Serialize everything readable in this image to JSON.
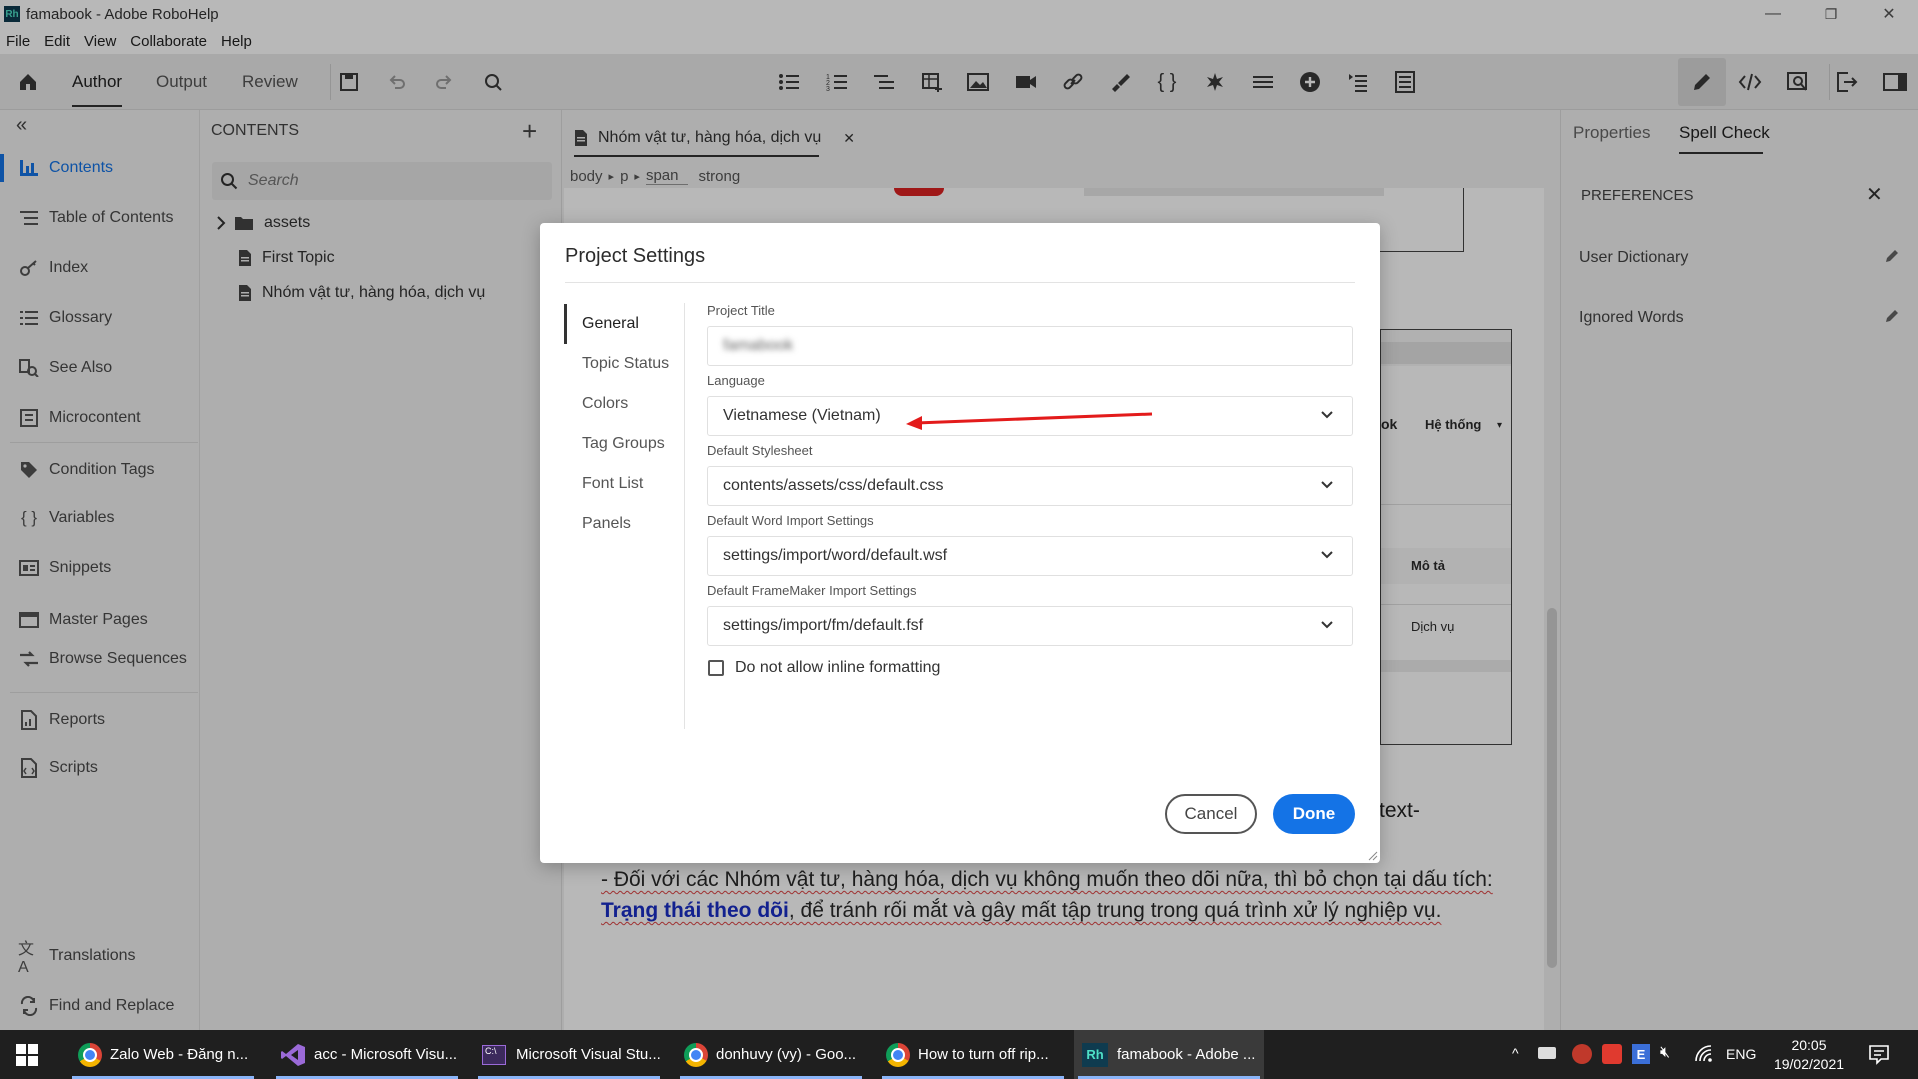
{
  "window": {
    "app_logo": "Rh",
    "title": "famabook - Adobe RoboHelp",
    "controls": {
      "minimize": "—",
      "restore": "❐",
      "close": "✕"
    }
  },
  "menu": [
    "File",
    "Edit",
    "View",
    "Collaborate",
    "Help"
  ],
  "toolbar": {
    "modes": [
      "Author",
      "Output",
      "Review"
    ],
    "active_mode": "Author"
  },
  "leftnav": {
    "collapse_icon": "«",
    "items": [
      {
        "label": "Contents",
        "icon": "contents-icon",
        "active": true
      },
      {
        "label": "Table of Contents",
        "icon": "toc-icon"
      },
      {
        "label": "Index",
        "icon": "index-icon"
      },
      {
        "label": "Glossary",
        "icon": "glossary-icon"
      },
      {
        "label": "See Also",
        "icon": "see-also-icon"
      },
      {
        "label": "Microcontent",
        "icon": "microcontent-icon"
      },
      {
        "label": "Condition Tags",
        "icon": "tag-icon"
      },
      {
        "label": "Variables",
        "icon": "variables-icon"
      },
      {
        "label": "Snippets",
        "icon": "snippets-icon"
      },
      {
        "label": "Master Pages",
        "icon": "master-pages-icon"
      },
      {
        "label": "Browse Sequences",
        "icon": "browse-sequences-icon"
      },
      {
        "label": "Reports",
        "icon": "reports-icon"
      },
      {
        "label": "Scripts",
        "icon": "scripts-icon"
      }
    ],
    "bottom_items": [
      {
        "label": "Translations",
        "icon": "translations-icon"
      },
      {
        "label": "Find and Replace",
        "icon": "find-replace-icon"
      }
    ]
  },
  "contents_panel": {
    "title": "CONTENTS",
    "add": "+",
    "search_placeholder": "Search",
    "tree": [
      {
        "label": "assets",
        "type": "folder"
      },
      {
        "label": "First Topic",
        "type": "file"
      },
      {
        "label": "Nhóm vật tư, hàng hóa, dịch vụ",
        "type": "file"
      }
    ]
  },
  "editor": {
    "tab_title": "Nhóm vật tư, hàng hóa, dịch vụ",
    "tab_close": "✕",
    "breadcrumb": [
      "body",
      "p",
      "span",
      "strong"
    ],
    "breadcrumb_sep": "▸",
    "bg_table": {
      "col_ok": "ok",
      "col_system": "Hệ thống",
      "col_desc": "Mô tả",
      "cell_service": "Dịch vụ"
    },
    "partial_text": "text-",
    "paragraph": {
      "part1": "- Đối với các Nhóm vật tư, hàng hóa, dịch vụ không muốn theo dõi nữa, thì bỏ chọn tại dấu tích: ",
      "bold_link": "Trạng thái theo dõi",
      "part2": ", để tránh rối mắt và gây mất tập trung trong quá trình xử lý nghiệp vụ."
    }
  },
  "right_panel": {
    "tabs": [
      "Properties",
      "Spell Check"
    ],
    "active_tab": "Spell Check",
    "section_title": "PREFERENCES",
    "close": "✕",
    "rows": [
      "User Dictionary",
      "Ignored Words"
    ]
  },
  "dialog": {
    "title": "Project Settings",
    "nav": [
      "General",
      "Topic Status",
      "Colors",
      "Tag Groups",
      "Font List",
      "Panels"
    ],
    "active_nav": "General",
    "fields": {
      "project_title_label": "Project Title",
      "project_title_value": "famabook",
      "language_label": "Language",
      "language_value": "Vietnamese (Vietnam)",
      "stylesheet_label": "Default Stylesheet",
      "stylesheet_value": "contents/assets/css/default.css",
      "word_label": "Default Word Import Settings",
      "word_value": "settings/import/word/default.wsf",
      "fm_label": "Default FrameMaker Import Settings",
      "fm_value": "settings/import/fm/default.fsf",
      "inline_label": "Do not allow inline formatting",
      "inline_checked": false
    },
    "buttons": {
      "cancel": "Cancel",
      "done": "Done"
    },
    "arrow_color": "#e31b1b"
  },
  "taskbar": {
    "items": [
      {
        "label": "Zalo Web - Đăng n...",
        "icon": "chrome-icon"
      },
      {
        "label": "acc - Microsoft Visu...",
        "icon": "visual-studio-icon"
      },
      {
        "label": "Microsoft Visual Stu...",
        "icon": "vs-console-icon"
      },
      {
        "label": "donhuvy (vy) - Goo...",
        "icon": "chrome-icon"
      },
      {
        "label": "How to turn off rip...",
        "icon": "chrome-icon"
      },
      {
        "label": "famabook - Adobe ...",
        "icon": "robohelp-icon",
        "active": true
      }
    ],
    "tray": {
      "lang": "ENG",
      "time": "20:05",
      "date": "19/02/2021"
    }
  },
  "colors": {
    "accent": "#1473e6",
    "taskbar": "#1f1f1f",
    "link": "#1a2fc7"
  }
}
